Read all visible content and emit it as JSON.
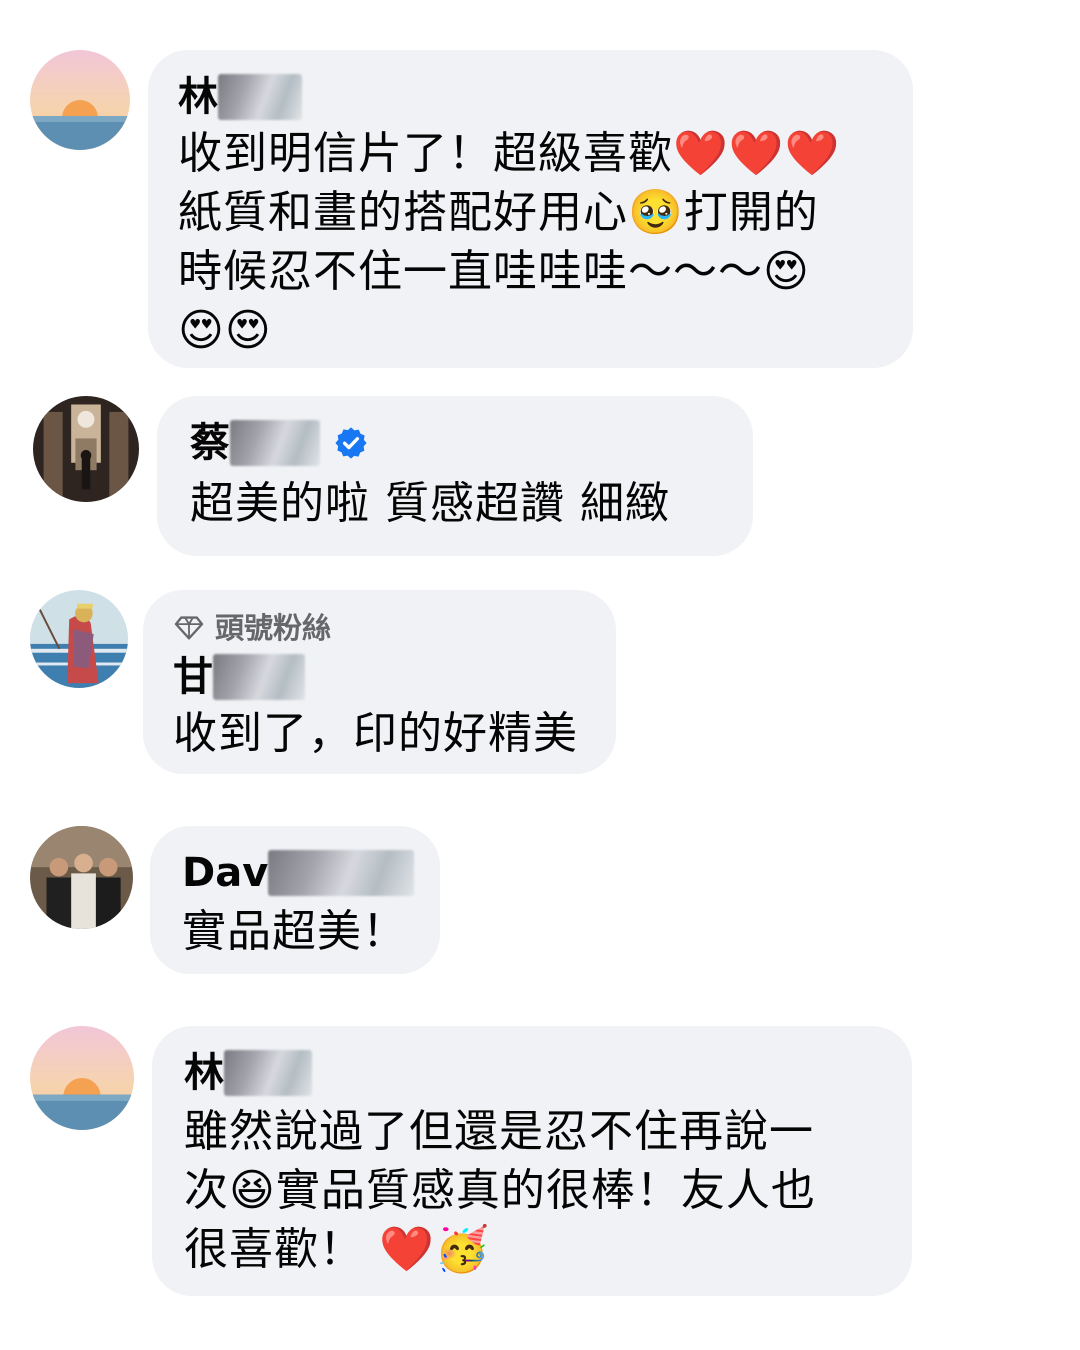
{
  "comments": [
    {
      "name_prefix": "林",
      "lines": [
        "收到明信片了！超級喜歡❤️❤️❤️",
        "紙質和畫的搭配好用心🥹打開的",
        "時候忍不住一直哇哇哇～～～😍",
        "😍😍"
      ],
      "avatar_icon": "sunset-avatar"
    },
    {
      "name_prefix": "蔡",
      "verified": true,
      "lines": [
        "超美的啦 質感超讚 細緻"
      ],
      "avatar_icon": "cathedral-photo-avatar"
    },
    {
      "badge": "頭號粉絲",
      "name_prefix": "甘",
      "lines": [
        "收到了，印的好精美"
      ],
      "avatar_icon": "painting-avatar"
    },
    {
      "name_prefix": "Dav",
      "lines": [
        "實品超美！"
      ],
      "avatar_icon": "group-photo-avatar"
    },
    {
      "name_prefix": "林",
      "lines": [
        "雖然說過了但還是忍不住再說一",
        "次😆實品質感真的很棒！友人也",
        "很喜歡！ ❤️🥳"
      ],
      "avatar_icon": "sunset-avatar"
    }
  ],
  "colors": {
    "bubble": "#f0f2f5",
    "text": "#050505",
    "secondary": "#65676b",
    "verified": "#1877f2"
  }
}
